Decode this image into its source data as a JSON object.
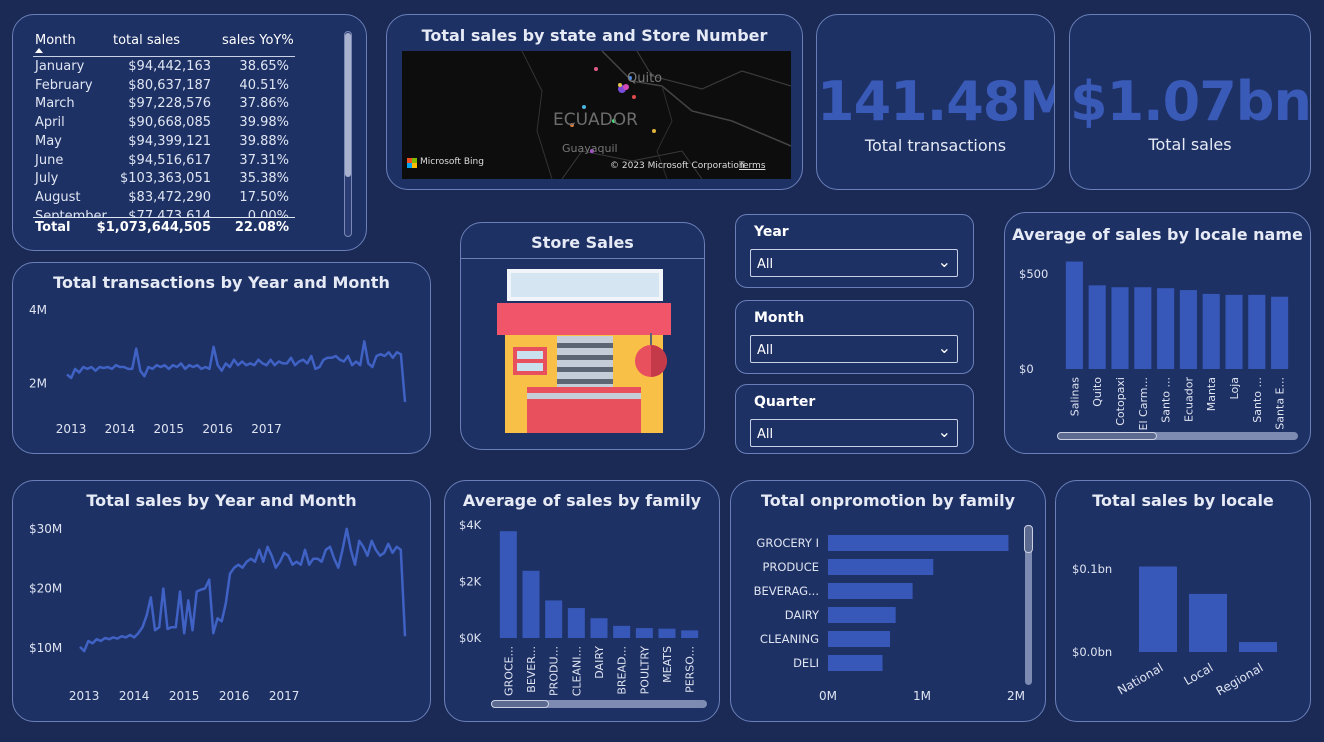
{
  "table": {
    "headers": [
      "Month",
      "total sales",
      "sales YoY%"
    ],
    "rows": [
      [
        "January",
        "$94,442,163",
        "38.65%"
      ],
      [
        "February",
        "$80,637,187",
        "40.51%"
      ],
      [
        "March",
        "$97,228,576",
        "37.86%"
      ],
      [
        "April",
        "$90,668,085",
        "39.98%"
      ],
      [
        "May",
        "$94,399,121",
        "39.88%"
      ],
      [
        "June",
        "$94,516,617",
        "37.31%"
      ],
      [
        "July",
        "$103,363,051",
        "35.38%"
      ],
      [
        "August",
        "$83,472,290",
        "17.50%"
      ],
      [
        "September",
        "$77,473,614",
        "0.00%"
      ]
    ],
    "total": [
      "Total",
      "$1,073,644,505",
      "22.08%"
    ]
  },
  "map": {
    "title": "Total sales by state and Store Number",
    "labels": {
      "country": "ECUADOR",
      "city1": "Quito",
      "city2": "Guayaquil"
    },
    "attribution": "© 2023 Microsoft Corporation",
    "terms": "Terms",
    "brand": "Microsoft Bing"
  },
  "kpi1": {
    "value": "141.48M",
    "label": "Total transactions"
  },
  "kpi2": {
    "value": "$1.07bn",
    "label": "Total sales"
  },
  "store": {
    "title": "Store Sales"
  },
  "slicers": [
    {
      "label": "Year",
      "value": "All"
    },
    {
      "label": "Month",
      "value": "All"
    },
    {
      "label": "Quarter",
      "value": "All"
    }
  ],
  "chart_data": [
    {
      "id": "trans_ym",
      "type": "line",
      "title": "Total transactions by Year and Month",
      "x_ticks": [
        "2013",
        "2014",
        "2015",
        "2016",
        "2017"
      ],
      "y_ticks": [
        "2M",
        "4M"
      ],
      "ylim": [
        1.2,
        4.3
      ],
      "values": [
        2.25,
        2.15,
        2.4,
        2.3,
        2.45,
        2.4,
        2.45,
        2.35,
        2.45,
        2.42,
        2.45,
        2.4,
        2.5,
        2.45,
        2.45,
        2.4,
        2.4,
        2.95,
        2.35,
        2.2,
        2.45,
        2.4,
        2.5,
        2.45,
        2.5,
        2.4,
        2.5,
        2.45,
        2.55,
        2.4,
        2.5,
        2.45,
        2.5,
        2.4,
        2.45,
        2.4,
        3.0,
        2.5,
        2.35,
        2.55,
        2.45,
        2.65,
        2.5,
        2.6,
        2.5,
        2.55,
        2.5,
        2.65,
        2.55,
        2.5,
        2.65,
        2.5,
        2.6,
        2.55,
        2.55,
        2.7,
        2.5,
        2.6,
        2.65,
        2.55,
        2.75,
        2.4,
        2.45,
        2.65,
        2.7,
        2.7,
        2.75,
        2.65,
        2.6,
        2.75,
        2.5,
        2.6,
        2.5,
        3.15,
        2.55,
        2.45,
        2.75,
        2.8,
        2.75,
        2.85,
        2.7,
        2.85,
        2.8,
        1.5
      ]
    },
    {
      "id": "sales_ym",
      "type": "line",
      "title": "Total sales by Year and Month",
      "x_ticks": [
        "2013",
        "2014",
        "2015",
        "2016",
        "2017"
      ],
      "y_ticks": [
        "$10M",
        "$20M",
        "$30M"
      ],
      "ylim": [
        7.5,
        32
      ],
      "values": [
        10.2,
        9.5,
        11.2,
        10.8,
        11.5,
        11.2,
        11.7,
        11.5,
        11.8,
        11.6,
        12.0,
        11.8,
        12.2,
        11.8,
        12.5,
        13.5,
        15.5,
        18.5,
        13.0,
        13.5,
        20.0,
        13.2,
        13.5,
        13.5,
        19.5,
        12.5,
        18.0,
        13.0,
        19.5,
        19.8,
        20.0,
        21.5,
        12.5,
        15.0,
        14.5,
        17.5,
        22.5,
        23.5,
        24.0,
        23.5,
        24.5,
        25.0,
        24.5,
        26.5,
        24.5,
        27.0,
        25.5,
        23.5,
        24.5,
        26.0,
        25.5,
        24.0,
        24.5,
        24.0,
        26.5,
        24.0,
        25.0,
        25.0,
        24.5,
        26.5,
        27.0,
        25.0,
        23.5,
        26.5,
        30.0,
        26.5,
        24.0,
        28.0,
        27.0,
        25.5,
        28.0,
        26.5,
        25.5,
        26.0,
        27.5,
        26.0,
        27.0,
        26.5,
        12.0
      ]
    },
    {
      "id": "avg_locale",
      "type": "bar",
      "title": "Average of sales by locale name",
      "categories": [
        "Salinas",
        "Quito",
        "Cotopaxi",
        "El Carm...",
        "Santo ...",
        "Ecuador",
        "Manta",
        "Loja",
        "Santo ...",
        "Santa E..."
      ],
      "values": [
        565,
        440,
        430,
        430,
        425,
        415,
        395,
        390,
        390,
        380
      ],
      "y_ticks": [
        "$0",
        "$500"
      ],
      "ylim": [
        0,
        610
      ]
    },
    {
      "id": "avg_family",
      "type": "bar",
      "title": "Average of sales by family",
      "categories": [
        "GROCE...",
        "BEVER...",
        "PRODU...",
        "CLEANI...",
        "DAIRY",
        "BREAD...",
        "POULTRY",
        "MEATS",
        "PERSO..."
      ],
      "values": [
        3780,
        2380,
        1330,
        1060,
        700,
        430,
        350,
        330,
        270
      ],
      "y_ticks": [
        "$0K",
        "$2K",
        "$4K"
      ],
      "ylim": [
        0,
        4000
      ]
    },
    {
      "id": "promo_family",
      "type": "bar",
      "title": "Total onpromotion by family",
      "orientation": "horizontal",
      "categories": [
        "GROCERY I",
        "PRODUCE",
        "BEVERAG...",
        "DAIRY",
        "CLEANING",
        "DELI"
      ],
      "values": [
        1.92,
        1.12,
        0.9,
        0.72,
        0.66,
        0.58
      ],
      "x_ticks": [
        "0M",
        "1M",
        "2M"
      ],
      "xlim": [
        0,
        2
      ]
    },
    {
      "id": "sales_locale",
      "type": "bar",
      "title": "Total sales by locale",
      "categories": [
        "National",
        "Local",
        "Regional"
      ],
      "values": [
        0.103,
        0.07,
        0.012
      ],
      "y_ticks": [
        "$0.0bn",
        "$0.1bn"
      ],
      "ylim": [
        0,
        0.1
      ]
    }
  ]
}
